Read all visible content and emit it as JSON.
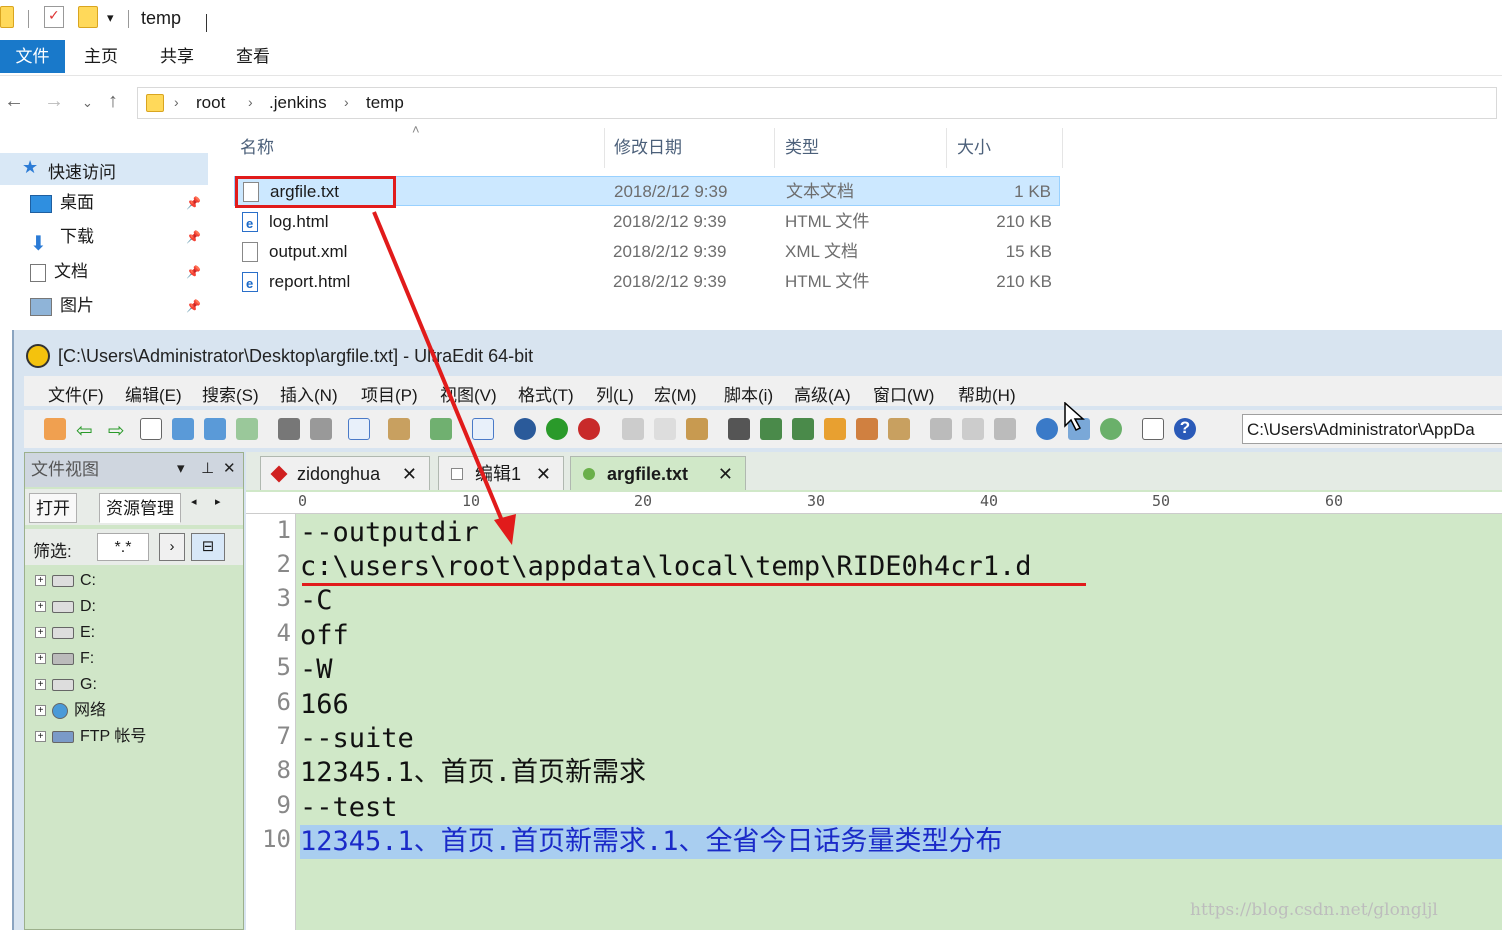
{
  "explorer": {
    "title": "temp",
    "ribbon_tabs": [
      "文件",
      "主页",
      "共享",
      "查看"
    ],
    "breadcrumb": [
      "root",
      ".jenkins",
      "temp"
    ],
    "quick_access": "快速访问",
    "nav_items": [
      "桌面",
      "下载",
      "文档",
      "图片"
    ],
    "columns": [
      "名称",
      "修改日期",
      "类型",
      "大小"
    ],
    "files": [
      {
        "name": "argfile.txt",
        "date": "2018/2/12 9:39",
        "type": "文本文档",
        "size": "1 KB"
      },
      {
        "name": "log.html",
        "date": "2018/2/12 9:39",
        "type": "HTML 文件",
        "size": "210 KB"
      },
      {
        "name": "output.xml",
        "date": "2018/2/12 9:39",
        "type": "XML 文档",
        "size": "15 KB"
      },
      {
        "name": "report.html",
        "date": "2018/2/12 9:39",
        "type": "HTML 文件",
        "size": "210 KB"
      }
    ]
  },
  "ultraedit": {
    "title": "[C:\\Users\\Administrator\\Desktop\\argfile.txt] - UltraEdit 64-bit",
    "menu": [
      "文件(F)",
      "编辑(E)",
      "搜索(S)",
      "插入(N)",
      "项目(P)",
      "视图(V)",
      "格式(T)",
      "列(L)",
      "宏(M)",
      "脚本(i)",
      "高级(A)",
      "窗口(W)",
      "帮助(H)"
    ],
    "toolbar_path": "C:\\Users\\Administrator\\AppDa",
    "panel": {
      "title": "文件视图",
      "tabs": [
        "打开",
        "资源管理"
      ],
      "filter_label": "筛选:",
      "filter_value": "*.*",
      "tree": [
        "C:",
        "D:",
        "E:",
        "F:",
        "G:",
        "网络",
        "FTP 帐号"
      ]
    },
    "tabs": [
      "zidonghua",
      "编辑1",
      "argfile.txt"
    ],
    "ruler": [
      "0",
      "10",
      "20",
      "30",
      "40",
      "50",
      "60"
    ],
    "lines": [
      {
        "n": "1",
        "text": "--outputdir"
      },
      {
        "n": "2",
        "text": "c:\\users\\root\\appdata\\local\\temp\\RIDE0h4cr1.d"
      },
      {
        "n": "3",
        "text": "-C"
      },
      {
        "n": "4",
        "text": "off"
      },
      {
        "n": "5",
        "text": "-W"
      },
      {
        "n": "6",
        "text": "166"
      },
      {
        "n": "7",
        "text": "--suite"
      },
      {
        "n": "8",
        "text": "12345.1、首页.首页新需求"
      },
      {
        "n": "9",
        "text": "--test"
      },
      {
        "n": "10",
        "text": "12345.1、首页.首页新需求.1、全省今日话务量类型分布"
      }
    ]
  },
  "watermark": "https://blog.csdn.net/glongljl",
  "colors": {
    "ribbon_active": "#1979ca",
    "selection": "#cce8ff",
    "editor_bg": "#d0e8c8",
    "highlight": "#e11b1b"
  }
}
